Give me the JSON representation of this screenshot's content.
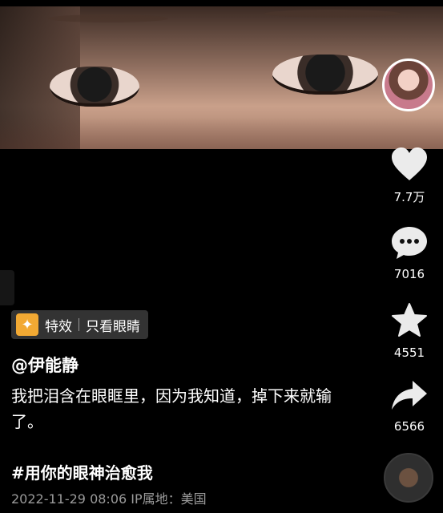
{
  "video": {
    "content": "close-up of eyes"
  },
  "author": {
    "avatar_icon": "avatar",
    "handle": "@伊能静"
  },
  "actions": {
    "like": {
      "icon": "heart-icon",
      "count": "7.7万"
    },
    "comment": {
      "icon": "comment-icon",
      "count": "7016"
    },
    "favorite": {
      "icon": "star-icon",
      "count": "4551"
    },
    "share": {
      "icon": "share-icon",
      "count": "6566"
    }
  },
  "effect": {
    "icon": "sparkle-icon",
    "label": "特效",
    "name": "只看眼睛"
  },
  "caption": "我把泪含在眼眶里，因为我知道，掉下来就输了。",
  "hashtag": "#用你的眼神治愈我",
  "meta": {
    "date": "2022-11-29 08:06",
    "ip_location": "IP属地：美国"
  },
  "colors": {
    "background": "#000000",
    "text": "#ffffff",
    "muted": "#9a9a9a",
    "tag_icon": "#f2a933"
  }
}
